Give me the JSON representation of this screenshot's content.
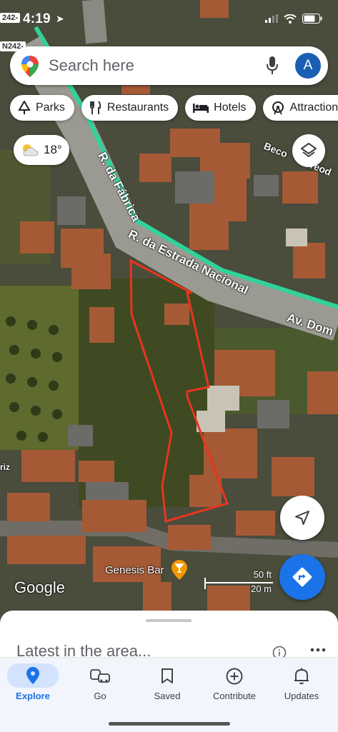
{
  "status": {
    "time": "4:19",
    "road_tag_top": "242-",
    "road_tag_left": "N242-"
  },
  "search": {
    "placeholder": "Search here",
    "avatar_letter": "A"
  },
  "chips": [
    {
      "label": "Parks",
      "icon": "tree-icon"
    },
    {
      "label": "Restaurants",
      "icon": "fork-knife-icon"
    },
    {
      "label": "Hotels",
      "icon": "bed-icon"
    },
    {
      "label": "Attractions",
      "icon": "ferris-wheel-icon"
    }
  ],
  "weather": {
    "temp": "18°",
    "icon": "partly-cloudy-icon"
  },
  "map": {
    "streets": [
      "R. da Fábrica",
      "R. da Estrada Nacional",
      "Av. Dom",
      "Beco",
      "Teod",
      "riz"
    ],
    "poi": "Genesis Bar",
    "scale_ft": "50 ft",
    "scale_m": "20 m",
    "attribution": "Google",
    "colors": {
      "route": "#2fd39a",
      "parcel": "#e8351e",
      "accent": "#1a73e8"
    }
  },
  "sheet": {
    "title": "Latest in the area..."
  },
  "nav": [
    {
      "label": "Explore",
      "icon": "location-pin-icon",
      "active": true
    },
    {
      "label": "Go",
      "icon": "car-icon",
      "active": false
    },
    {
      "label": "Saved",
      "icon": "bookmark-icon",
      "active": false
    },
    {
      "label": "Contribute",
      "icon": "plus-circle-icon",
      "active": false
    },
    {
      "label": "Updates",
      "icon": "bell-icon",
      "active": false
    }
  ]
}
